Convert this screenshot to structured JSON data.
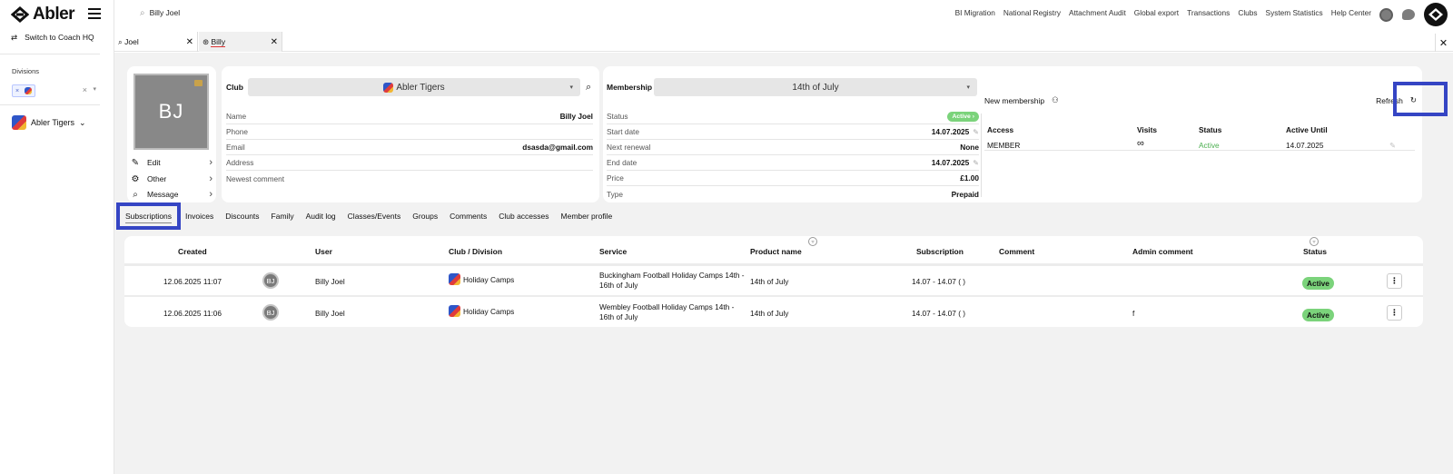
{
  "brand": "Abler",
  "sidebar": {
    "switch_label": "Switch to Coach HQ",
    "divisions_label": "Divisions",
    "chip_x": "×",
    "club_name": "Abler Tigers",
    "clear": "×",
    "caret": "▾"
  },
  "topbar": {
    "search_value": "Billy Joel",
    "nav": [
      "BI Migration",
      "National Registry",
      "Attachment Audit",
      "Global export",
      "Transactions",
      "Clubs",
      "System Statistics",
      "Help Center"
    ]
  },
  "tabs": [
    {
      "label": "Joel",
      "close": "✕"
    },
    {
      "label": "Billy",
      "close": "✕"
    }
  ],
  "close_all": "✕",
  "profile": {
    "initials": "BJ",
    "actions": [
      "Edit",
      "Other",
      "Message"
    ],
    "chevron": "›"
  },
  "club": {
    "label": "Club",
    "value": "Abler Tigers",
    "fields": [
      {
        "k": "Name",
        "v": "Billy Joel"
      },
      {
        "k": "Phone",
        "v": ""
      },
      {
        "k": "Email",
        "v": "dsasda@gmail.com"
      },
      {
        "k": "Address",
        "v": ""
      },
      {
        "k": "Newest comment",
        "v": ""
      }
    ]
  },
  "membership": {
    "label": "Membership",
    "value": "14th of July",
    "new_label": "New membership",
    "refresh_label": "Refresh",
    "status_badge": "Active",
    "fields": [
      {
        "k": "Status",
        "v": ""
      },
      {
        "k": "Start date",
        "v": "14.07.2025"
      },
      {
        "k": "Next renewal",
        "v": "None"
      },
      {
        "k": "End date",
        "v": "14.07.2025"
      },
      {
        "k": "Price",
        "v": "£1.00"
      },
      {
        "k": "Type",
        "v": "Prepaid"
      }
    ],
    "access_headers": [
      "Access",
      "Visits",
      "Status",
      "Active Until"
    ],
    "access_row": [
      "MEMBER",
      "∞",
      "Active",
      "14.07.2025"
    ]
  },
  "subtabs": [
    "Subscriptions",
    "Invoices",
    "Discounts",
    "Family",
    "Audit log",
    "Classes/Events",
    "Groups",
    "Comments",
    "Club accesses",
    "Member profile"
  ],
  "table": {
    "headers": [
      "Created",
      "User",
      "Club / Division",
      "Service",
      "Product name",
      "Subscription",
      "Comment",
      "Admin comment",
      "Status"
    ],
    "rows": [
      {
        "created": "12.06.2025 11:07",
        "initials": "BJ",
        "user": "Billy Joel",
        "club": "Holiday Camps",
        "service": "Buckingham Football Holiday Camps 14th - 16th of July",
        "product": "14th of July",
        "subscription": "14.07 - 14.07 ( )",
        "comment": "",
        "admin_comment": "",
        "status": "Active"
      },
      {
        "created": "12.06.2025 11:06",
        "initials": "BJ",
        "user": "Billy Joel",
        "club": "Holiday Camps",
        "service": "Wembley Football Holiday Camps 14th - 16th of July",
        "product": "14th of July",
        "subscription": "14.07 - 14.07 ( )",
        "comment": "",
        "admin_comment": "f",
        "status": "Active"
      }
    ],
    "more_glyph": "⋮"
  },
  "colors": {
    "highlight": "#3545c4",
    "active_badge": "#7bd37b",
    "active_text": "#4caf50"
  }
}
